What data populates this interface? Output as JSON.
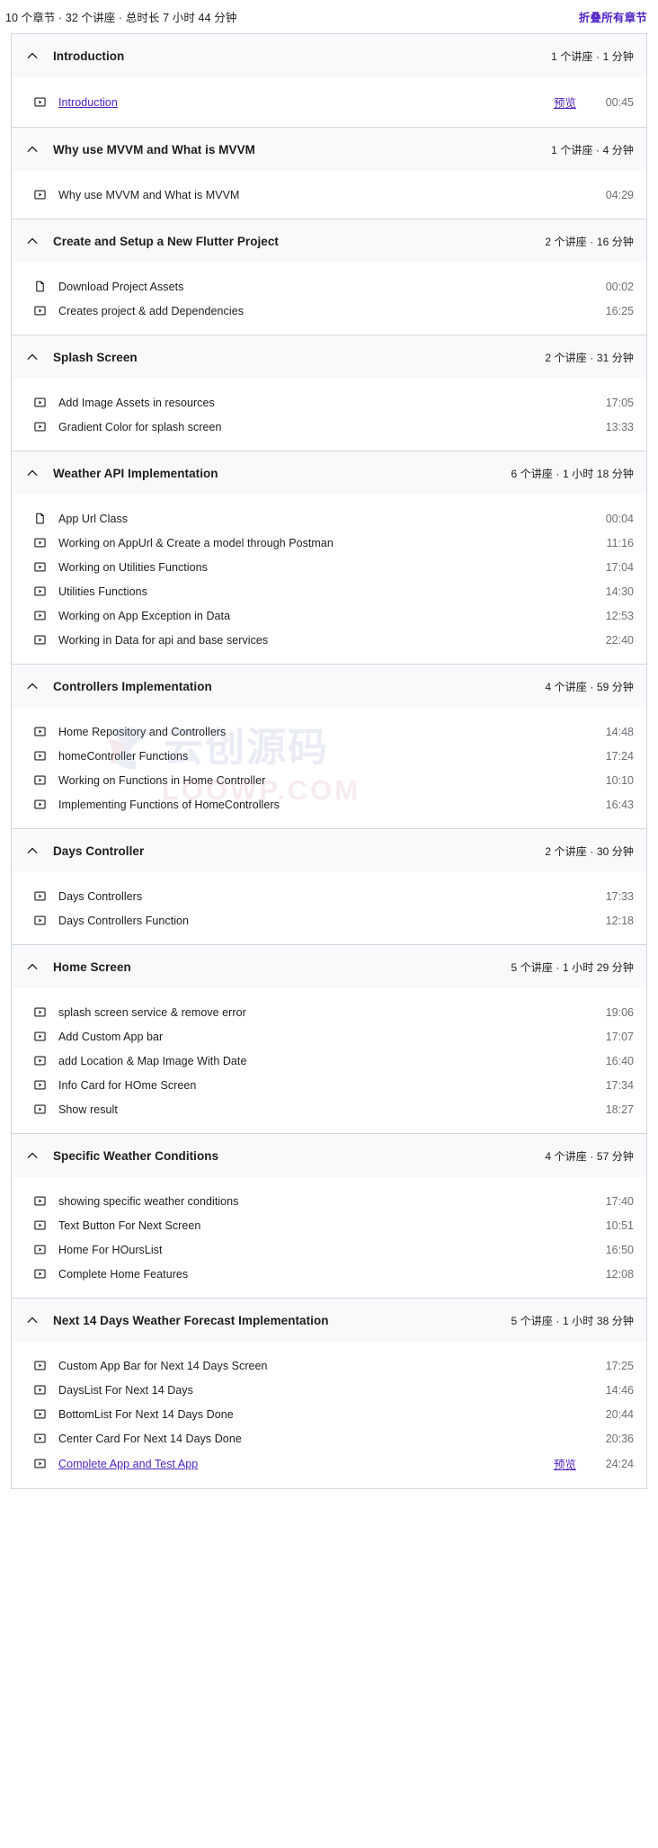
{
  "summary": {
    "text": "10 个章节 · 32 个讲座 · 总时长 7 小时 44 分钟",
    "collapse_all_label": "折叠所有章节",
    "accent_color": "#5022c3",
    "header_bg": "#f7f9fa",
    "border_color": "#d1d7dc",
    "duration_color": "#6a6f73"
  },
  "icons": {
    "collapse_chevron": "chevron-up-icon",
    "video": "video-icon",
    "article": "article-icon"
  },
  "labels": {
    "preview": "预览"
  },
  "watermark": {
    "cn_text": "云创源码",
    "domain_text": "LOOWP.COM"
  },
  "sections": [
    {
      "title": "Introduction",
      "meta": "1 个讲座 · 1 分钟",
      "lectures": [
        {
          "title": "Introduction",
          "duration": "00:45",
          "type": "video",
          "link": true,
          "preview": true
        }
      ]
    },
    {
      "title": "Why use MVVM and What is MVVM",
      "meta": "1 个讲座 · 4 分钟",
      "lectures": [
        {
          "title": "Why use MVVM and What is MVVM",
          "duration": "04:29",
          "type": "video",
          "link": false,
          "preview": false
        }
      ]
    },
    {
      "title": "Create and Setup a New Flutter Project",
      "meta": "2 个讲座 · 16 分钟",
      "lectures": [
        {
          "title": "Download Project Assets",
          "duration": "00:02",
          "type": "article",
          "link": false,
          "preview": false
        },
        {
          "title": "Creates project & add Dependencies",
          "duration": "16:25",
          "type": "video",
          "link": false,
          "preview": false
        }
      ]
    },
    {
      "title": "Splash Screen",
      "meta": "2 个讲座 · 31 分钟",
      "lectures": [
        {
          "title": "Add Image Assets in resources",
          "duration": "17:05",
          "type": "video",
          "link": false,
          "preview": false
        },
        {
          "title": "Gradient Color for splash screen",
          "duration": "13:33",
          "type": "video",
          "link": false,
          "preview": false
        }
      ]
    },
    {
      "title": "Weather API Implementation",
      "meta": "6 个讲座 · 1 小时 18 分钟",
      "lectures": [
        {
          "title": "App Url Class",
          "duration": "00:04",
          "type": "article",
          "link": false,
          "preview": false
        },
        {
          "title": "Working on AppUrl & Create a model through Postman",
          "duration": "11:16",
          "type": "video",
          "link": false,
          "preview": false
        },
        {
          "title": "Working on Utilities Functions",
          "duration": "17:04",
          "type": "video",
          "link": false,
          "preview": false
        },
        {
          "title": "Utilities Functions",
          "duration": "14:30",
          "type": "video",
          "link": false,
          "preview": false
        },
        {
          "title": "Working on App Exception in Data",
          "duration": "12:53",
          "type": "video",
          "link": false,
          "preview": false
        },
        {
          "title": "Working in Data for api and base services",
          "duration": "22:40",
          "type": "video",
          "link": false,
          "preview": false
        }
      ]
    },
    {
      "title": "Controllers Implementation",
      "meta": "4 个讲座 · 59 分钟",
      "lectures": [
        {
          "title": "Home Repository and Controllers",
          "duration": "14:48",
          "type": "video",
          "link": false,
          "preview": false
        },
        {
          "title": "homeController Functions",
          "duration": "17:24",
          "type": "video",
          "link": false,
          "preview": false
        },
        {
          "title": "Working on Functions in Home Controller",
          "duration": "10:10",
          "type": "video",
          "link": false,
          "preview": false
        },
        {
          "title": "Implementing Functions of HomeControllers",
          "duration": "16:43",
          "type": "video",
          "link": false,
          "preview": false
        }
      ]
    },
    {
      "title": "Days Controller",
      "meta": "2 个讲座 · 30 分钟",
      "lectures": [
        {
          "title": "Days Controllers",
          "duration": "17:33",
          "type": "video",
          "link": false,
          "preview": false
        },
        {
          "title": "Days Controllers Function",
          "duration": "12:18",
          "type": "video",
          "link": false,
          "preview": false
        }
      ]
    },
    {
      "title": "Home Screen",
      "meta": "5 个讲座 · 1 小时 29 分钟",
      "lectures": [
        {
          "title": "splash screen service & remove error",
          "duration": "19:06",
          "type": "video",
          "link": false,
          "preview": false
        },
        {
          "title": "Add Custom App bar",
          "duration": "17:07",
          "type": "video",
          "link": false,
          "preview": false
        },
        {
          "title": "add Location & Map Image With Date",
          "duration": "16:40",
          "type": "video",
          "link": false,
          "preview": false
        },
        {
          "title": "Info Card for HOme Screen",
          "duration": "17:34",
          "type": "video",
          "link": false,
          "preview": false
        },
        {
          "title": "Show result",
          "duration": "18:27",
          "type": "video",
          "link": false,
          "preview": false
        }
      ]
    },
    {
      "title": "Specific Weather Conditions",
      "meta": "4 个讲座 · 57 分钟",
      "lectures": [
        {
          "title": "showing specific weather conditions",
          "duration": "17:40",
          "type": "video",
          "link": false,
          "preview": false
        },
        {
          "title": "Text Button For Next Screen",
          "duration": "10:51",
          "type": "video",
          "link": false,
          "preview": false
        },
        {
          "title": "Home For HOursList",
          "duration": "16:50",
          "type": "video",
          "link": false,
          "preview": false
        },
        {
          "title": "Complete Home Features",
          "duration": "12:08",
          "type": "video",
          "link": false,
          "preview": false
        }
      ]
    },
    {
      "title": "Next 14 Days Weather Forecast Implementation",
      "meta": "5 个讲座 · 1 小时 38 分钟",
      "lectures": [
        {
          "title": "Custom App Bar for Next 14 Days Screen",
          "duration": "17:25",
          "type": "video",
          "link": false,
          "preview": false
        },
        {
          "title": "DaysList For Next 14 Days",
          "duration": "14:46",
          "type": "video",
          "link": false,
          "preview": false
        },
        {
          "title": "BottomList For Next 14 Days Done",
          "duration": "20:44",
          "type": "video",
          "link": false,
          "preview": false
        },
        {
          "title": "Center Card For Next 14 Days Done",
          "duration": "20:36",
          "type": "video",
          "link": false,
          "preview": false
        },
        {
          "title": "Complete App and Test App",
          "duration": "24:24",
          "type": "video",
          "link": true,
          "preview": true
        }
      ]
    }
  ]
}
